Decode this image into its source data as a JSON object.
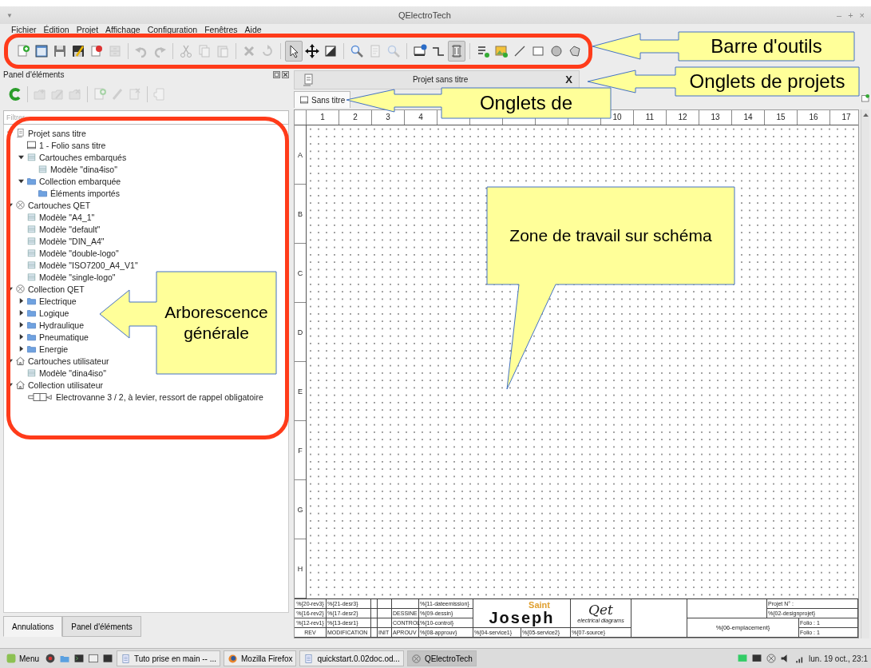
{
  "window": {
    "title": "QElectroTech",
    "menu_glyph": "▼",
    "controls": [
      "–",
      "+",
      "×"
    ]
  },
  "menu": [
    "Fichier",
    "Édition",
    "Projet",
    "Affichage",
    "Configuration",
    "Fenêtres",
    "Aide"
  ],
  "toolbar": {
    "groups": [
      {
        "items": [
          {
            "kind": "page-plus",
            "disabled": false,
            "selected": false
          },
          {
            "kind": "window",
            "disabled": false,
            "selected": false
          },
          {
            "kind": "floppy",
            "disabled": false,
            "selected": false
          },
          {
            "kind": "floppy-pen",
            "disabled": false,
            "selected": false
          },
          {
            "kind": "page-badge",
            "disabled": false,
            "selected": false
          },
          {
            "kind": "cabinet",
            "disabled": true,
            "selected": false
          }
        ]
      },
      {
        "items": [
          {
            "kind": "undo",
            "disabled": true,
            "selected": false
          },
          {
            "kind": "redo",
            "disabled": true,
            "selected": false
          }
        ]
      },
      {
        "items": [
          {
            "kind": "cut",
            "disabled": true,
            "selected": false
          },
          {
            "kind": "copy",
            "disabled": true,
            "selected": false
          },
          {
            "kind": "paste",
            "disabled": true,
            "selected": false
          }
        ]
      },
      {
        "items": [
          {
            "kind": "delete",
            "disabled": true,
            "selected": false
          },
          {
            "kind": "rotate",
            "disabled": true,
            "selected": false
          }
        ]
      },
      {
        "items": [
          {
            "kind": "pointer",
            "disabled": false,
            "selected": true
          },
          {
            "kind": "move",
            "disabled": false,
            "selected": false
          },
          {
            "kind": "shaded-square",
            "disabled": false,
            "selected": false
          }
        ]
      },
      {
        "items": [
          {
            "kind": "zoom",
            "disabled": false,
            "selected": false
          },
          {
            "kind": "page",
            "disabled": true,
            "selected": false
          },
          {
            "kind": "zoom",
            "disabled": true,
            "selected": false
          }
        ]
      },
      {
        "items": [
          {
            "kind": "monitor-info",
            "disabled": false,
            "selected": false
          },
          {
            "kind": "wire",
            "disabled": false,
            "selected": false
          },
          {
            "kind": "conductor",
            "disabled": false,
            "selected": true
          }
        ]
      },
      {
        "items": [
          {
            "kind": "text-tool",
            "disabled": false,
            "selected": false
          },
          {
            "kind": "image",
            "disabled": false,
            "selected": false
          },
          {
            "kind": "line",
            "disabled": false,
            "selected": false
          },
          {
            "kind": "rectangle",
            "disabled": false,
            "selected": false
          },
          {
            "kind": "ellipse",
            "disabled": false,
            "selected": false
          },
          {
            "kind": "polygon",
            "disabled": false,
            "selected": false
          }
        ]
      }
    ]
  },
  "elements_panel": {
    "title": "Panel d'éléments",
    "tools": [
      {
        "kind": "refresh",
        "disabled": false
      },
      {
        "kind": "folder-plus",
        "disabled": true
      },
      {
        "kind": "folder-pen",
        "disabled": true
      },
      {
        "kind": "folder-x",
        "disabled": true
      },
      {
        "kind": "page-plus",
        "disabled": true
      },
      {
        "kind": "pen",
        "disabled": true
      },
      {
        "kind": "page-x",
        "disabled": true
      },
      {
        "kind": "page-arrow",
        "disabled": true
      }
    ],
    "filter": {
      "placeholder": "Filtrer"
    },
    "tree": [
      {
        "label": "Projet sans titre",
        "kind": "project",
        "expanded": true,
        "children": [
          {
            "label": "1 - Folio sans titre",
            "kind": "folio"
          },
          {
            "label": "Cartouches embarqués",
            "kind": "titleblock",
            "expanded": true,
            "children": [
              {
                "label": "Modèle \"dina4iso\"",
                "kind": "titleblock"
              }
            ]
          },
          {
            "label": "Collection embarquée",
            "kind": "folder",
            "expanded": true,
            "children": [
              {
                "label": "Éléments importés",
                "kind": "folder"
              }
            ]
          }
        ]
      },
      {
        "label": "Cartouches QET",
        "kind": "qet",
        "expanded": true,
        "children": [
          {
            "label": "Modèle \"A4_1\"",
            "kind": "titleblock"
          },
          {
            "label": "Modèle \"default\"",
            "kind": "titleblock"
          },
          {
            "label": "Modèle \"DIN_A4\"",
            "kind": "titleblock"
          },
          {
            "label": "Modèle \"double-logo\"",
            "kind": "titleblock"
          },
          {
            "label": "Modèle \"ISO7200_A4_V1\"",
            "kind": "titleblock"
          },
          {
            "label": "Modèle \"single-logo\"",
            "kind": "titleblock"
          }
        ]
      },
      {
        "label": "Collection QET",
        "kind": "qet",
        "expanded": true,
        "children": [
          {
            "label": "Electrique",
            "kind": "folder",
            "expanded": false
          },
          {
            "label": "Logique",
            "kind": "folder",
            "expanded": false
          },
          {
            "label": "Hydraulique",
            "kind": "folder",
            "expanded": false
          },
          {
            "label": "Pneumatique",
            "kind": "folder",
            "expanded": false
          },
          {
            "label": "Energie",
            "kind": "folder",
            "expanded": false
          }
        ]
      },
      {
        "label": "Cartouches utilisateur",
        "kind": "home",
        "expanded": true,
        "children": [
          {
            "label": "Modèle \"dina4iso\"",
            "kind": "titleblock"
          }
        ]
      },
      {
        "label": "Collection utilisateur",
        "kind": "home",
        "expanded": true,
        "children": [
          {
            "label": "Electrovanne 3 / 2, à levier, ressort de rappel obligatoire",
            "kind": "valve"
          }
        ]
      }
    ]
  },
  "bottom_tabs": [
    {
      "label": "Annulations",
      "selected": true
    },
    {
      "label": "Panel d'éléments",
      "selected": false
    }
  ],
  "project_tab": {
    "title": "Projet sans titre",
    "close": "X"
  },
  "folio_tabs": [
    {
      "label": "Sans titre",
      "selected": true
    }
  ],
  "canvas": {
    "columns": [
      "1",
      "2",
      "3",
      "4",
      null,
      null,
      null,
      null,
      null,
      "10",
      "11",
      "12",
      "13",
      "14",
      "15",
      "16",
      "17"
    ],
    "rows": [
      "A",
      "B",
      "C",
      "D",
      "E",
      "F",
      "G",
      "H"
    ],
    "title_block": {
      "rows": [
        {
          "rev": "%{20-rev3}",
          "desc": "%{21-desr3}",
          "value": "%{11-dateemission}"
        },
        {
          "rev": "%{16-rev2}",
          "desc": "%{17-desr2}",
          "role": "DESSINE",
          "value": "%{09-dessin}"
        },
        {
          "rev": "%{12-rev1}",
          "desc": "%{13-desr1}",
          "role": "CONTROL",
          "value": "%{10-control}"
        },
        {
          "rev": "REV",
          "desc": "MODIFICATION",
          "init": "INIT",
          "role": "APROUV",
          "value": "%{08-approuv}"
        }
      ],
      "logo": {
        "main": "Joseph",
        "overlay": "Saint"
      },
      "qet_logo": {
        "text": "Qet",
        "tagline": "electrical diagrams"
      },
      "services": [
        "%{04-service1}",
        "%{05-service2}",
        "%{07-source}"
      ],
      "project_label": "Projet N° :",
      "project_value": "%{02-designprojet}",
      "location": "%{06-emplacement}",
      "folios": [
        "Folio : 1",
        "Folio : 1"
      ]
    }
  },
  "taskbar": {
    "menu": "Menu",
    "windows": [
      {
        "label": "Tuto prise en main -- ...",
        "kind": "document",
        "selected": false
      },
      {
        "label": "Mozilla Firefox",
        "kind": "globe",
        "selected": false
      },
      {
        "label": "quickstart.0.02doc.od...",
        "kind": "document",
        "selected": false
      },
      {
        "label": "QElectroTech",
        "kind": "qet",
        "selected": true
      }
    ],
    "clock": "lun. 19 oct., 23:1"
  },
  "annotations": [
    {
      "text": "Barre d'outils"
    },
    {
      "text": "Onglets de projets"
    },
    {
      "text": "Onglets de"
    },
    {
      "text": "Zone de travail sur schéma"
    },
    {
      "text": "Arborescence générale"
    }
  ]
}
